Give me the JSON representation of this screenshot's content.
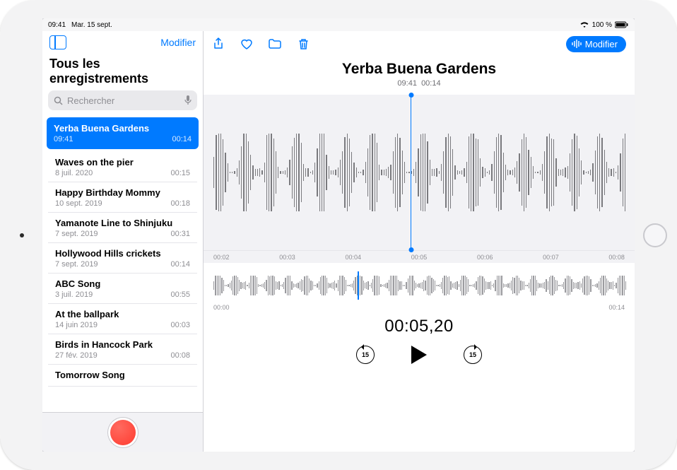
{
  "status": {
    "time": "09:41",
    "date": "Mar. 15 sept.",
    "battery": "100 %"
  },
  "sidebar": {
    "edit": "Modifier",
    "title": "Tous les enregistrements",
    "search_placeholder": "Rechercher",
    "items": [
      {
        "title": "Yerba Buena Gardens",
        "date": "09:41",
        "dur": "00:14",
        "selected": true
      },
      {
        "title": "Waves on the pier",
        "date": "8 juil. 2020",
        "dur": "00:15"
      },
      {
        "title": "Happy Birthday Mommy",
        "date": "10 sept. 2019",
        "dur": "00:18"
      },
      {
        "title": "Yamanote Line to Shinjuku",
        "date": "7 sept. 2019",
        "dur": "00:31"
      },
      {
        "title": "Hollywood Hills crickets",
        "date": "7 sept. 2019",
        "dur": "00:14"
      },
      {
        "title": "ABC Song",
        "date": "3 juil. 2019",
        "dur": "00:55"
      },
      {
        "title": "At the ballpark",
        "date": "14 juin 2019",
        "dur": "00:03"
      },
      {
        "title": "Birds in Hancock Park",
        "date": "27 fév. 2019",
        "dur": "00:08"
      },
      {
        "title": "Tomorrow Song",
        "date": "",
        "dur": ""
      }
    ]
  },
  "toolbar": {
    "modify": "Modifier"
  },
  "detail": {
    "title": "Yerba Buena Gardens",
    "sub_time": "09:41",
    "sub_dur": "00:14",
    "ruler": [
      "00:02",
      "00:03",
      "00:04",
      "00:05",
      "00:06",
      "00:07",
      "00:08"
    ],
    "overview_start": "00:00",
    "overview_end": "00:14",
    "current": "00:05,20",
    "skip": "15"
  },
  "colors": {
    "accent": "#007aff",
    "record": "#ff3b30"
  }
}
